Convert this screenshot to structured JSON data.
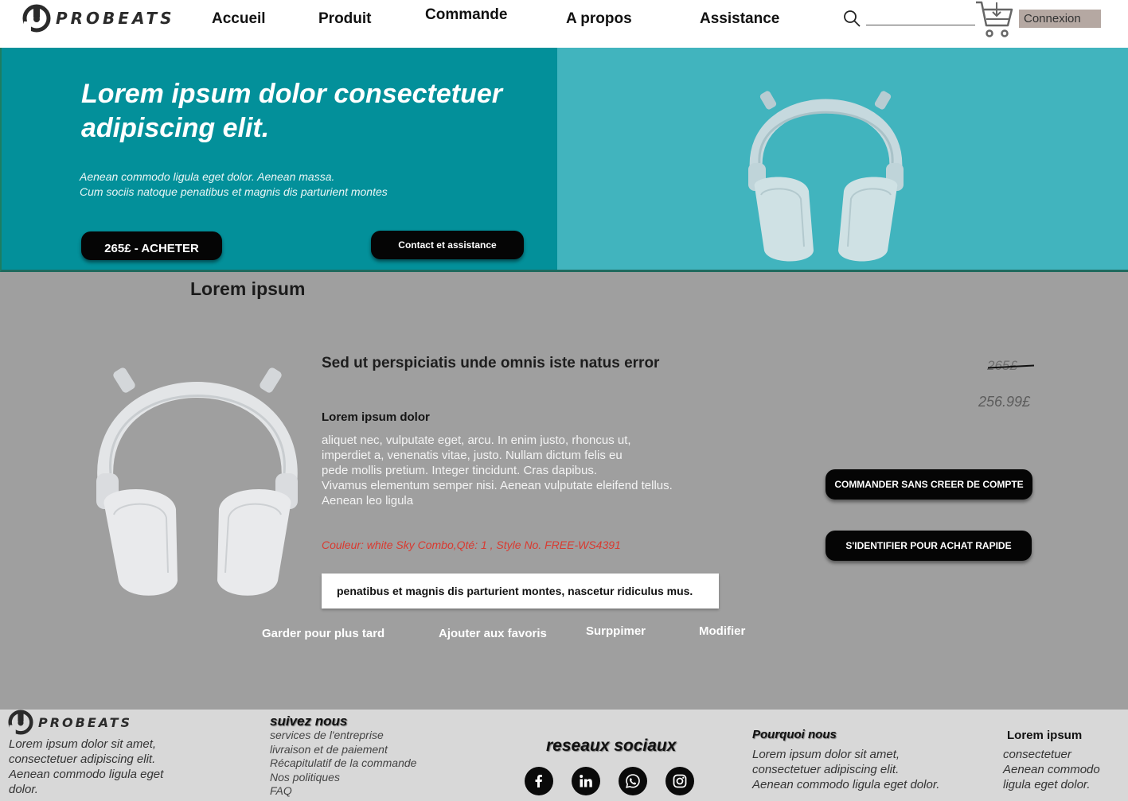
{
  "brand": {
    "name": "PROBEATS"
  },
  "nav": {
    "items": [
      "Accueil",
      "Produit",
      "Commande",
      "A propos",
      "Assistance"
    ]
  },
  "header": {
    "search_icon": "search-icon",
    "cart_icon": "cart-icon",
    "login_label": "Connexion"
  },
  "hero": {
    "title": "Lorem ipsum dolor consectetuer adipiscing elit.",
    "subtitle": "Aenean commodo ligula eget dolor. Aenean massa.\n Cum sociis natoque penatibus et magnis dis parturient montes",
    "buy_label": "265£ - ACHETER",
    "contact_label": "Contact et assistance",
    "background_colors": {
      "left": "#03909a",
      "right": "#41b4be"
    }
  },
  "product": {
    "section_title": "Lorem ipsum",
    "name": "Sed ut perspiciatis unde omnis iste natus error",
    "subtitle": "Lorem ipsum dolor",
    "description": "aliquet nec, vulputate eget, arcu. In enim justo, rhoncus ut,\n imperdiet a, venenatis vitae, justo. Nullam dictum felis eu\npede mollis pretium. Integer tincidunt. Cras dapibus.\nVivamus elementum semper nisi. Aenean vulputate eleifend tellus.\nAenean leo ligula",
    "meta": "Couleur: white Sky Combo,Qté: 1 , Style No. FREE-WS4391",
    "note": "penatibus et magnis dis parturient montes, nascetur ridiculus mus.",
    "old_price": "265£",
    "new_price": "256.99£",
    "cta_guest": "COMMANDER SANS CREER DE COMPTE",
    "cta_login": "S'IDENTIFIER POUR ACHAT RAPIDE",
    "actions": {
      "later": "Garder pour plus tard",
      "favorite": "Ajouter aux favoris",
      "delete": "Surppimer",
      "edit": "Modifier"
    },
    "accent_color": "#d93a30"
  },
  "footer": {
    "brand": "PROBEATS",
    "about_text": "Lorem ipsum dolor sit amet,\nconsectetuer adipiscing elit.\nAenean commodo ligula eget\ndolor.",
    "follow_heading": "suivez nous",
    "links": [
      "services de l'entreprise",
      "livraison et de paiement",
      "Récapitulatif de la commande",
      "Nos politiques",
      "FAQ"
    ],
    "social_heading": "reseaux sociaux",
    "social_icons": [
      "facebook-icon",
      "linkedin-icon",
      "whatsapp-icon",
      "instagram-icon"
    ],
    "why_heading": "Pourquoi nous",
    "why_text": "Lorem ipsum dolor sit amet,\nconsectetuer adipiscing elit.\nAenean commodo ligula eget dolor.",
    "extra_heading": "Lorem ipsum",
    "extra_text": "consectetuer\nAenean commodo\nligula eget dolor."
  }
}
